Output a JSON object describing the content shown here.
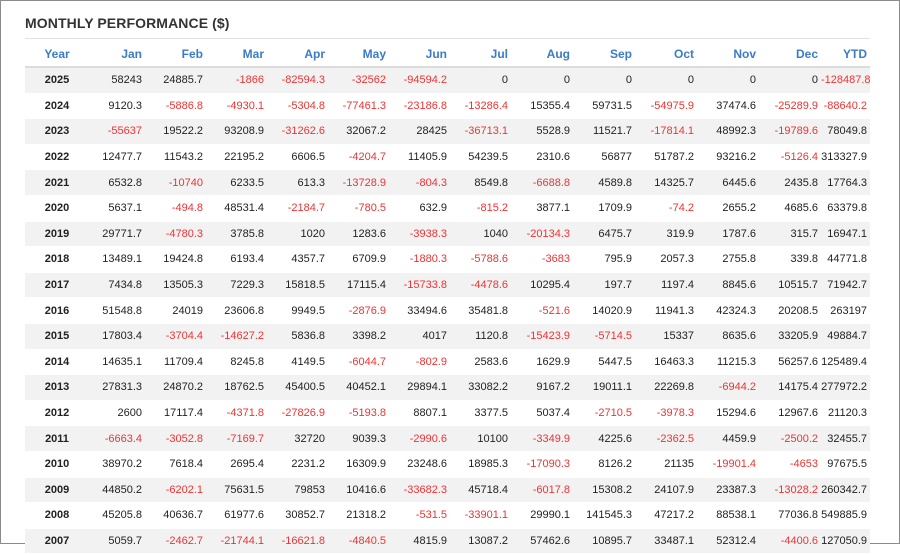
{
  "title": "MONTHLY PERFORMANCE ($)",
  "colors": {
    "header": "#3a7cc6",
    "negative": "#ee3333",
    "stripe": "#f2f2f2"
  },
  "columns": [
    "Year",
    "Jan",
    "Feb",
    "Mar",
    "Apr",
    "May",
    "Jun",
    "Jul",
    "Aug",
    "Sep",
    "Oct",
    "Nov",
    "Dec",
    "YTD"
  ],
  "rows": [
    [
      "2025",
      "58243",
      "24885.7",
      "-1866",
      "-82594.3",
      "-32562",
      "-94594.2",
      "0",
      "0",
      "0",
      "0",
      "0",
      "0",
      "-128487.8"
    ],
    [
      "2024",
      "9120.3",
      "-5886.8",
      "-4930.1",
      "-5304.8",
      "-77461.3",
      "-23186.8",
      "-13286.4",
      "15355.4",
      "59731.5",
      "-54975.9",
      "37474.6",
      "-25289.9",
      "-88640.2"
    ],
    [
      "2023",
      "-55637",
      "19522.2",
      "93208.9",
      "-31262.6",
      "32067.2",
      "28425",
      "-36713.1",
      "5528.9",
      "11521.7",
      "-17814.1",
      "48992.3",
      "-19789.6",
      "78049.8"
    ],
    [
      "2022",
      "12477.7",
      "11543.2",
      "22195.2",
      "6606.5",
      "-4204.7",
      "11405.9",
      "54239.5",
      "2310.6",
      "56877",
      "51787.2",
      "93216.2",
      "-5126.4",
      "313327.9"
    ],
    [
      "2021",
      "6532.8",
      "-10740",
      "6233.5",
      "613.3",
      "-13728.9",
      "-804.3",
      "8549.8",
      "-6688.8",
      "4589.8",
      "14325.7",
      "6445.6",
      "2435.8",
      "17764.3"
    ],
    [
      "2020",
      "5637.1",
      "-494.8",
      "48531.4",
      "-2184.7",
      "-780.5",
      "632.9",
      "-815.2",
      "3877.1",
      "1709.9",
      "-74.2",
      "2655.2",
      "4685.6",
      "63379.8"
    ],
    [
      "2019",
      "29771.7",
      "-4780.3",
      "3785.8",
      "1020",
      "1283.6",
      "-3938.3",
      "1040",
      "-20134.3",
      "6475.7",
      "319.9",
      "1787.6",
      "315.7",
      "16947.1"
    ],
    [
      "2018",
      "13489.1",
      "19424.8",
      "6193.4",
      "4357.7",
      "6709.9",
      "-1880.3",
      "-5788.6",
      "-3683",
      "795.9",
      "2057.3",
      "2755.8",
      "339.8",
      "44771.8"
    ],
    [
      "2017",
      "7434.8",
      "13505.3",
      "7229.3",
      "15818.5",
      "17115.4",
      "-15733.8",
      "-4478.6",
      "10295.4",
      "197.7",
      "1197.4",
      "8845.6",
      "10515.7",
      "71942.7"
    ],
    [
      "2016",
      "51548.8",
      "24019",
      "23606.8",
      "9949.5",
      "-2876.9",
      "33494.6",
      "35481.8",
      "-521.6",
      "14020.9",
      "11941.3",
      "42324.3",
      "20208.5",
      "263197"
    ],
    [
      "2015",
      "17803.4",
      "-3704.4",
      "-14627.2",
      "5836.8",
      "3398.2",
      "4017",
      "1120.8",
      "-15423.9",
      "-5714.5",
      "15337",
      "8635.6",
      "33205.9",
      "49884.7"
    ],
    [
      "2014",
      "14635.1",
      "11709.4",
      "8245.8",
      "4149.5",
      "-6044.7",
      "-802.9",
      "2583.6",
      "1629.9",
      "5447.5",
      "16463.3",
      "11215.3",
      "56257.6",
      "125489.4"
    ],
    [
      "2013",
      "27831.3",
      "24870.2",
      "18762.5",
      "45400.5",
      "40452.1",
      "29894.1",
      "33082.2",
      "9167.2",
      "19011.1",
      "22269.8",
      "-6944.2",
      "14175.4",
      "277972.2"
    ],
    [
      "2012",
      "2600",
      "17117.4",
      "-4371.8",
      "-27826.9",
      "-5193.8",
      "8807.1",
      "3377.5",
      "5037.4",
      "-2710.5",
      "-3978.3",
      "15294.6",
      "12967.6",
      "21120.3"
    ],
    [
      "2011",
      "-6663.4",
      "-3052.8",
      "-7169.7",
      "32720",
      "9039.3",
      "-2990.6",
      "10100",
      "-3349.9",
      "4225.6",
      "-2362.5",
      "4459.9",
      "-2500.2",
      "32455.7"
    ],
    [
      "2010",
      "38970.2",
      "7618.4",
      "2695.4",
      "2231.2",
      "16309.9",
      "23248.6",
      "18985.3",
      "-17090.3",
      "8126.2",
      "21135",
      "-19901.4",
      "-4653",
      "97675.5"
    ],
    [
      "2009",
      "44850.2",
      "-6202.1",
      "75631.5",
      "79853",
      "10416.6",
      "-33682.3",
      "45718.4",
      "-6017.8",
      "15308.2",
      "24107.9",
      "23387.3",
      "-13028.2",
      "260342.7"
    ],
    [
      "2008",
      "45205.8",
      "40636.7",
      "61977.6",
      "30852.7",
      "21318.2",
      "-531.5",
      "-33901.1",
      "29990.1",
      "141545.3",
      "47217.2",
      "88538.1",
      "77036.8",
      "549885.9"
    ],
    [
      "2007",
      "5059.7",
      "-2462.7",
      "-21744.1",
      "-16621.8",
      "-4840.5",
      "4815.9",
      "13087.2",
      "57462.6",
      "10895.7",
      "33487.1",
      "52312.4",
      "-4400.6",
      "127050.9"
    ]
  ]
}
